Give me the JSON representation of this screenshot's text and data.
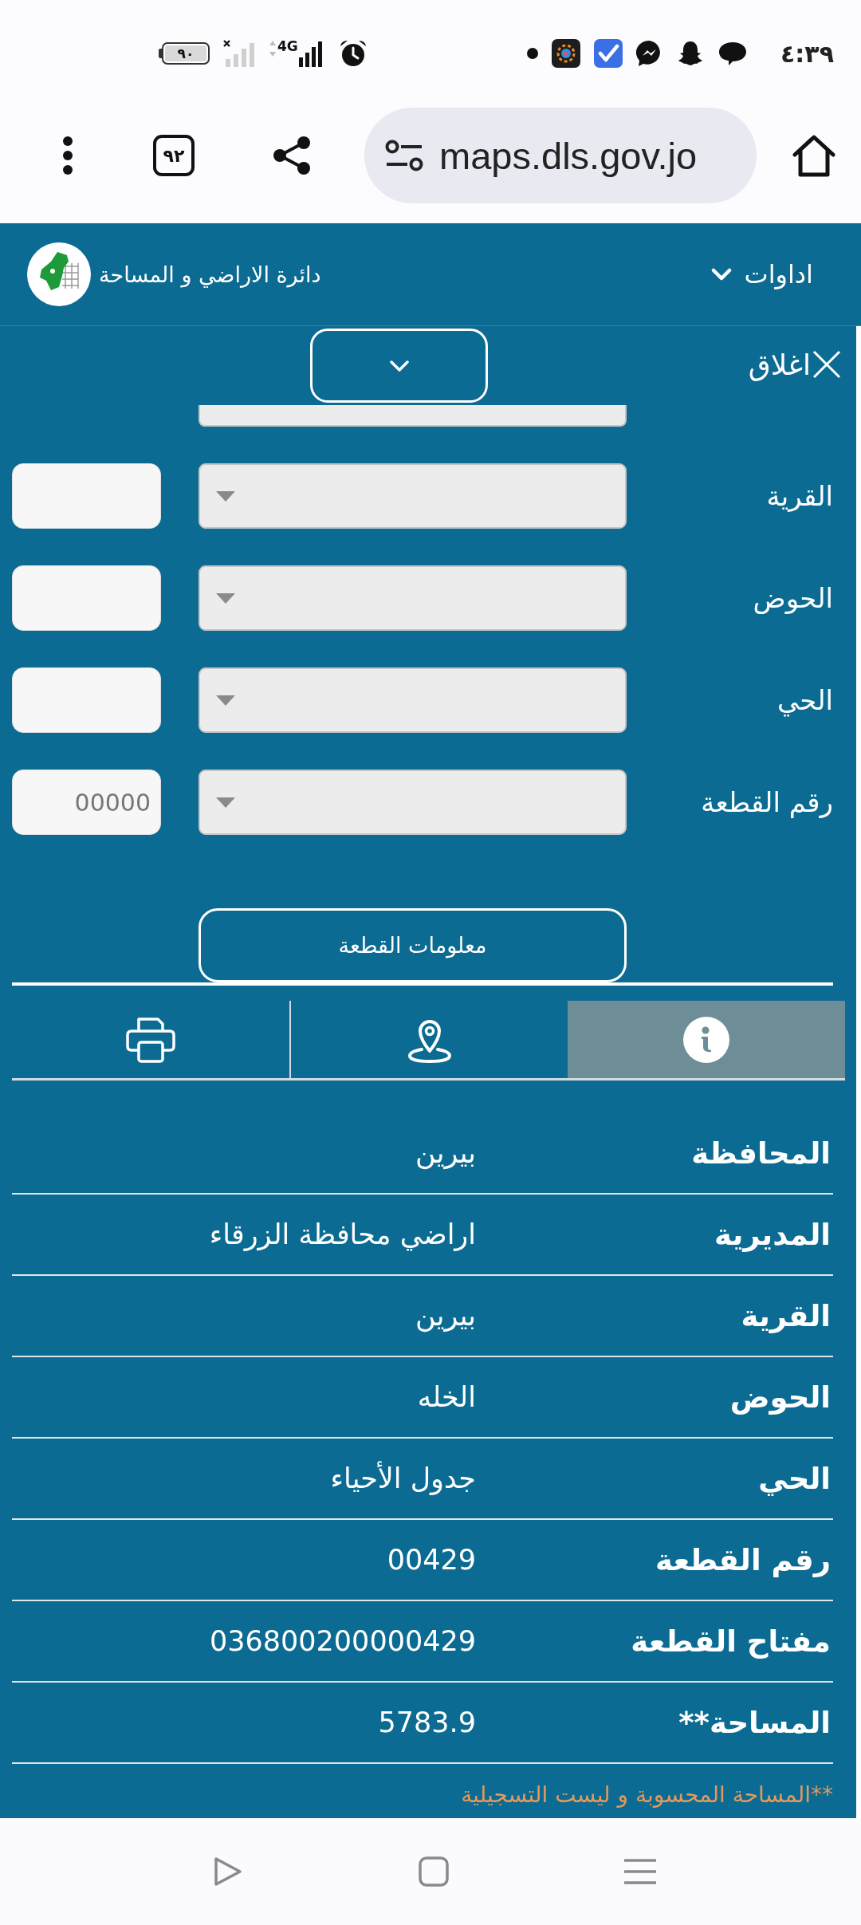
{
  "status_bar": {
    "battery": "٩٠",
    "network": "4G",
    "time": "٤:٣٩"
  },
  "browser": {
    "tab_count": "٩٢",
    "url": "maps.dls.gov.jo"
  },
  "header": {
    "title": "دائرة الاراضي و المساحة",
    "tools_menu": "اداوات"
  },
  "panel": {
    "close_label": "اغلاق"
  },
  "form": {
    "rows": [
      {
        "label": "القرية"
      },
      {
        "label": "الحوض"
      },
      {
        "label": "الحي"
      },
      {
        "label": "رقم القطعة",
        "placeholder": "00000"
      }
    ],
    "submit": "معلومات القطعة"
  },
  "tabs": [
    {
      "kind": "info",
      "selected": true
    },
    {
      "kind": "location",
      "selected": false
    },
    {
      "kind": "print",
      "selected": false
    }
  ],
  "details": {
    "rows": [
      {
        "label": "المحافظة",
        "value": "بيرين"
      },
      {
        "label": "المديرية",
        "value": "اراضي محافظة الزرقاء"
      },
      {
        "label": "القرية",
        "value": "بيرين"
      },
      {
        "label": "الحوض",
        "value": "الخله"
      },
      {
        "label": "الحي",
        "value": "جدول الأحياء"
      },
      {
        "label": "رقم القطعة",
        "value": "00429"
      },
      {
        "label": "مفتاح القطعة",
        "value": "036800200000429"
      },
      {
        "label": "المساحة**",
        "value": "5783.9"
      }
    ],
    "footnote": "**المساحة المحسوبة و ليست التسجيلية"
  }
}
